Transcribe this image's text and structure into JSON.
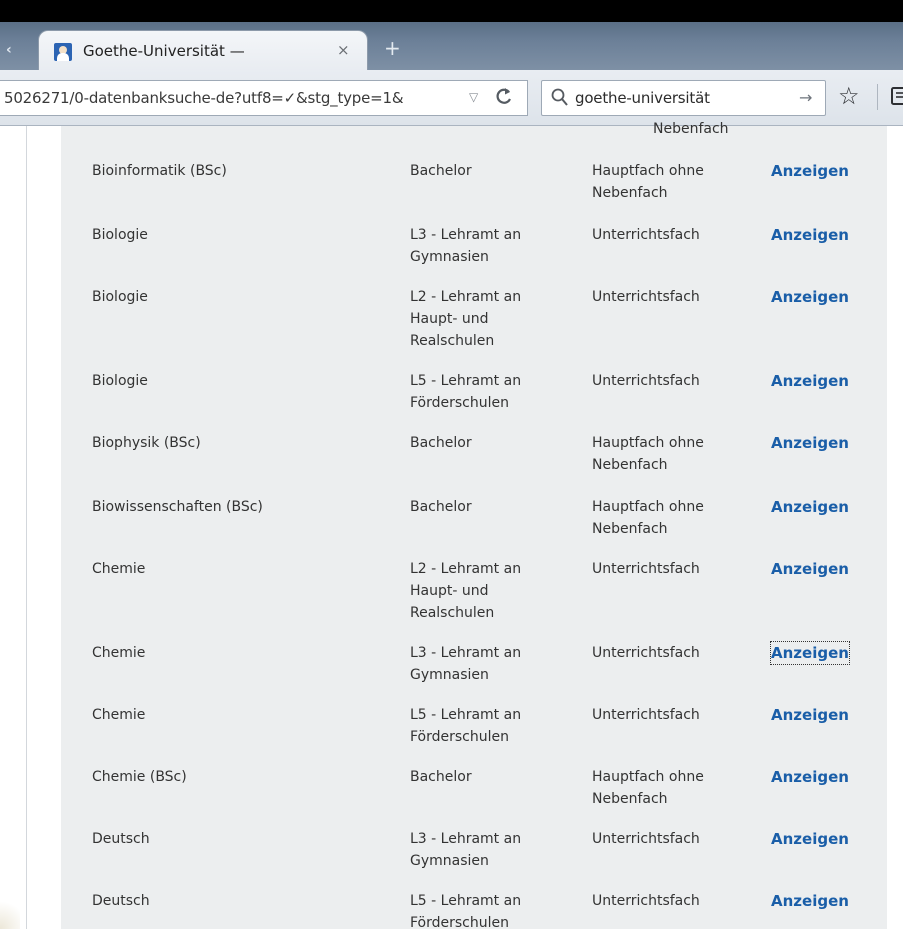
{
  "browser": {
    "tab_prev_glyph": "‹",
    "tab": {
      "title": "Goethe-Universität —",
      "close_glyph": "×",
      "favicon": "person-portrait-icon"
    },
    "new_tab_glyph": "+",
    "url": "5026271/0-datenbanksuche-de?utf8=✓&stg_type=1&",
    "url_dropdown_glyph": "▽",
    "reload_glyph": "C",
    "search": {
      "value": "goethe-universität",
      "go_glyph": "→"
    },
    "bookmark_glyph": "☆"
  },
  "table": {
    "cut_row_text": "Nebenfach",
    "rows": [
      {
        "name": "Bioinformatik (BSc)",
        "degree": "Bachelor",
        "type": "Hauptfach ohne\nNebenfach",
        "action": "Anzeigen"
      },
      {
        "name": "Biologie",
        "degree": "L3 - Lehramt an\nGymnasien",
        "type": "Unterrichtsfach",
        "action": "Anzeigen"
      },
      {
        "name": "Biologie",
        "degree": "L2 - Lehramt an\nHaupt- und\nRealschulen",
        "type": "Unterrichtsfach",
        "action": "Anzeigen"
      },
      {
        "name": "Biologie",
        "degree": "L5 - Lehramt an\nFörderschulen",
        "type": "Unterrichtsfach",
        "action": "Anzeigen"
      },
      {
        "name": "Biophysik (BSc)",
        "degree": "Bachelor",
        "type": "Hauptfach ohne\nNebenfach",
        "action": "Anzeigen"
      },
      {
        "name": "Biowissenschaften (BSc)",
        "degree": "Bachelor",
        "type": "Hauptfach ohne\nNebenfach",
        "action": "Anzeigen"
      },
      {
        "name": "Chemie",
        "degree": "L2 - Lehramt an\nHaupt- und\nRealschulen",
        "type": "Unterrichtsfach",
        "action": "Anzeigen"
      },
      {
        "name": "Chemie",
        "degree": "L3 - Lehramt an\nGymnasien",
        "type": "Unterrichtsfach",
        "action": "Anzeigen"
      },
      {
        "name": "Chemie",
        "degree": "L5 - Lehramt an\nFörderschulen",
        "type": "Unterrichtsfach",
        "action": "Anzeigen"
      },
      {
        "name": "Chemie (BSc)",
        "degree": "Bachelor",
        "type": "Hauptfach ohne\nNebenfach",
        "action": "Anzeigen"
      },
      {
        "name": "Deutsch",
        "degree": "L3 - Lehramt an\nGymnasien",
        "type": "Unterrichtsfach",
        "action": "Anzeigen"
      },
      {
        "name": "Deutsch",
        "degree": "L5 - Lehramt an\nFörderschulen",
        "type": "Unterrichtsfach",
        "action": "Anzeigen"
      }
    ]
  }
}
